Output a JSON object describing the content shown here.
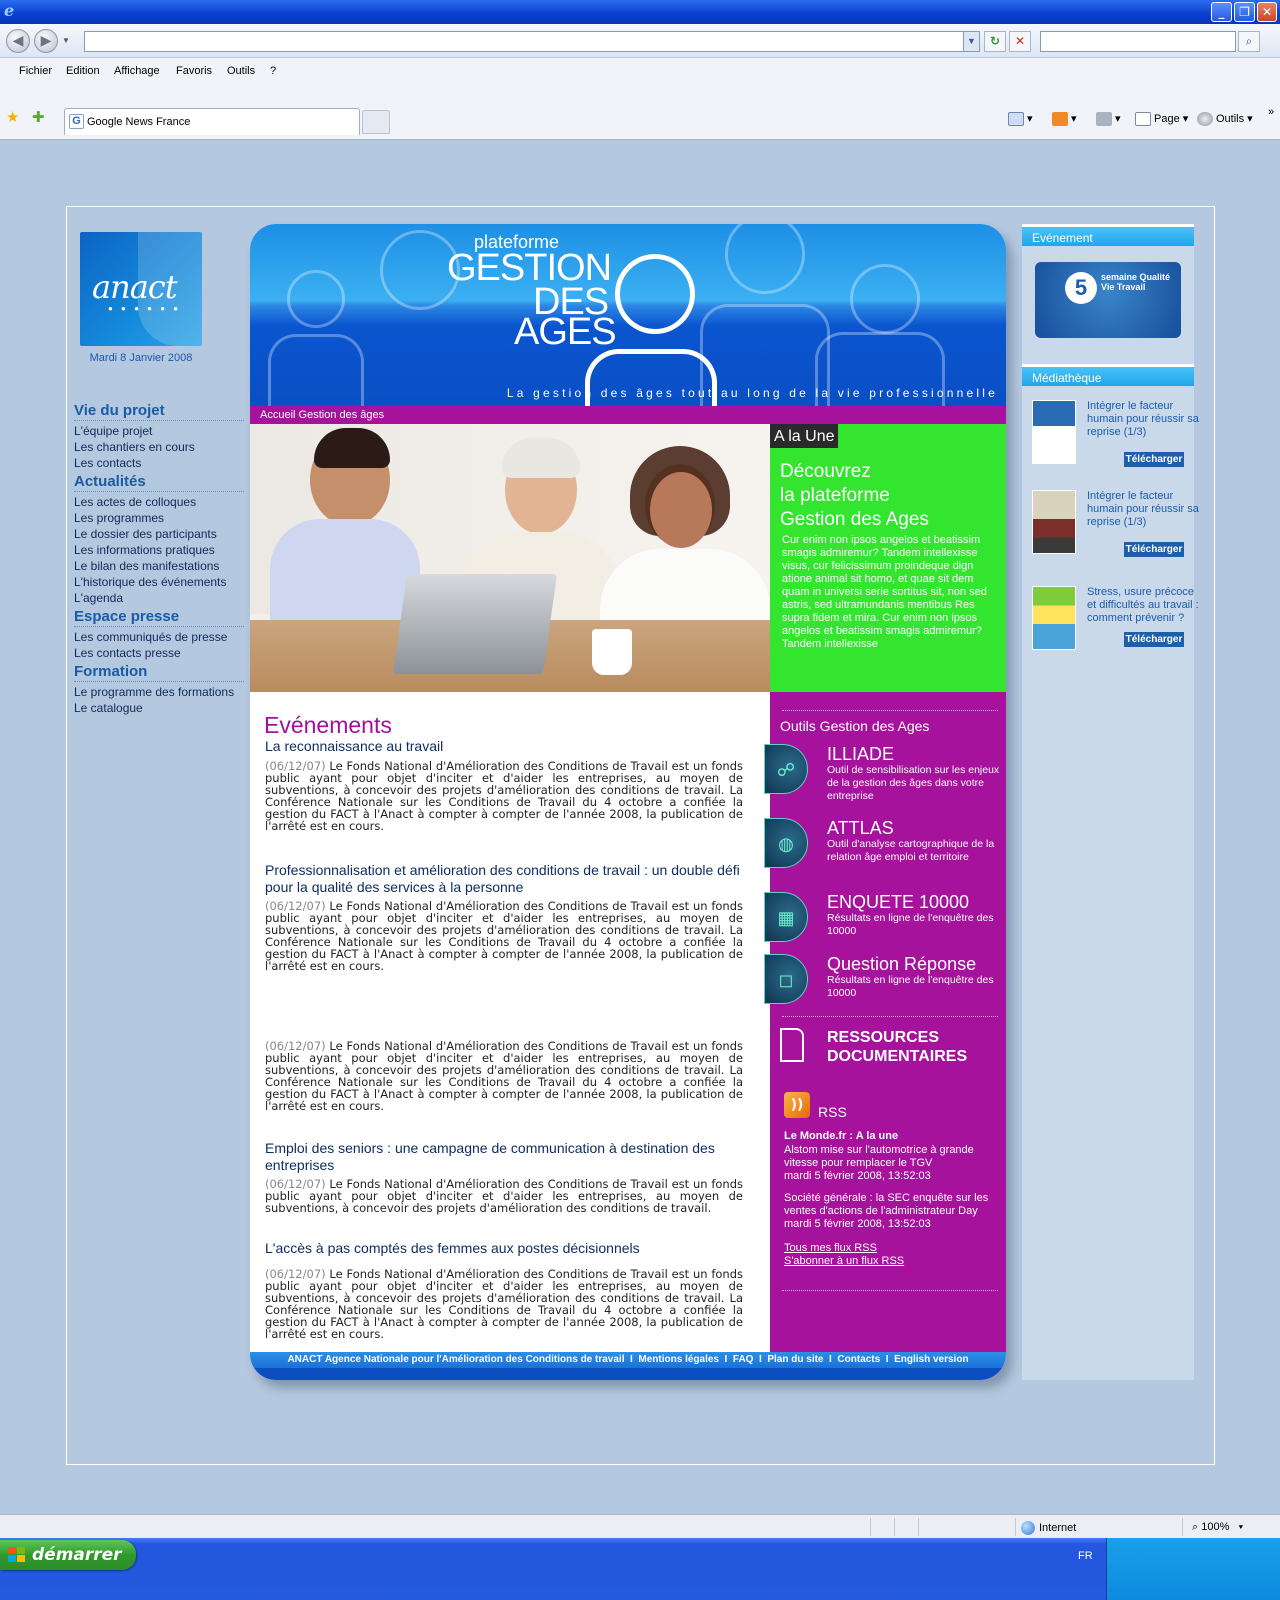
{
  "browser": {
    "menu": [
      "Fichier",
      "Edition",
      "Affichage",
      "Favoris",
      "Outils",
      "?"
    ],
    "tab_title": "Google News France",
    "address_value": "",
    "search_value": "",
    "cmd_page": "Page",
    "cmd_tools": "Outils",
    "status_zone": "Internet",
    "zoom": "100%"
  },
  "taskbar": {
    "start_label": "démarrer",
    "lang": "FR"
  },
  "site": {
    "logo_word": "anact",
    "date": "Mardi 8 Janvier 2008",
    "banner": {
      "pre": "plateforme",
      "line1": "GESTION",
      "line2": "DES",
      "line3": "AGES",
      "tagline": "La gestion des âges tout au long de la vie professionnelle"
    },
    "breadcrumb": "Accueil Gestion des âges",
    "nav": [
      {
        "head": "Vie du projet",
        "items": [
          "L'équipe projet",
          "Les chantiers en cours",
          "Les contacts"
        ]
      },
      {
        "head": "Actualités",
        "items": [
          "Les actes de colloques",
          "Les programmes",
          "Le dossier des participants",
          "Les informations pratiques",
          "Le bilan des manifestations",
          "L'historique des événements",
          "L'agenda"
        ]
      },
      {
        "head": "Espace presse",
        "items": [
          "Les communiqués de presse",
          "Les contacts presse"
        ]
      },
      {
        "head": "Formation",
        "items": [
          "Le programme des formations",
          "Le catalogue"
        ]
      }
    ],
    "une": {
      "tag": "A la Une",
      "title_l1": "Découvrez",
      "title_l2": "la plateforme",
      "title_l3": "Gestion des Ages",
      "text": "Cur enim non ipsos angelos et beatissim smagis admiremur? Tandem intellexisse visus, cur felicissimum proindeque dign atione animal sit homo, et quae sit dem quam in universi serie sortitus sit, non sed astris, sed ultramundanis mentibus Res supra fidem et mira. Cur enim non ipsos angelos et beatissim smagis admiremur? Tandem intellexisse"
    },
    "events": {
      "heading": "Evénements",
      "items": [
        {
          "title": "La reconnaissance au travail",
          "date": "(06/12/07)",
          "text": " Le Fonds National d'Amélioration des Conditions de Travail est un fonds public ayant pour objet d'inciter et d'aider les entreprises, au moyen de subventions, à concevoir des projets d'amélioration des conditions de travail. La Conférence Nationale sur les Conditions de Travail du 4 octobre a confiée la gestion du FACT à l'Anact à compter à compter de l'année 2008, la publication de l'arrêté est en cours."
        },
        {
          "title": "Professionnalisation et amélioration des conditions de travail : un double défi pour la qualité des services à la personne",
          "date": "(06/12/07)",
          "text": " Le Fonds National d'Amélioration des Conditions de Travail est un fonds public ayant pour objet d'inciter et d'aider les entreprises, au moyen de subventions, à concevoir des projets d'amélioration des conditions de travail. La Conférence Nationale sur les Conditions de Travail du 4 octobre a confiée la gestion du FACT à l'Anact à compter à compter de l'année 2008, la publication de l'arrêté est en cours."
        },
        {
          "title": "",
          "date": "(06/12/07)",
          "text": " Le Fonds National d'Amélioration des Conditions de Travail est un fonds public ayant pour objet d'inciter et d'aider les entreprises, au moyen de subventions, à concevoir des projets d'amélioration des conditions de travail. La Conférence Nationale sur les Conditions de Travail du 4 octobre a confiée la gestion du FACT à l'Anact à compter à compter de l'année 2008, la publication de l'arrêté est en cours."
        },
        {
          "title": "Emploi des seniors : une campagne de communication à destination des entreprises",
          "date": "(06/12/07)",
          "text": " Le Fonds National d'Amélioration des Conditions de Travail est un fonds public ayant pour objet d'inciter et d'aider les entreprises, au moyen de subventions, à concevoir des projets d'amélioration des conditions de travail."
        },
        {
          "title": "L'accès à pas comptés des femmes aux postes décisionnels",
          "date": "(06/12/07)",
          "text": " Le Fonds National d'Amélioration des Conditions de Travail est un fonds public ayant pour objet d'inciter et d'aider les entreprises, au moyen de subventions, à concevoir des projets d'amélioration des conditions de travail. La Conférence Nationale sur les Conditions de Travail du 4 octobre a confiée la gestion du FACT à l'Anact à compter à compter de l'année 2008, la publication de l'arrêté est en cours."
        }
      ]
    },
    "tools": {
      "heading": "Outils Gestion des Ages",
      "items": [
        {
          "name": "ILLIADE",
          "desc": "Outil de sensibilisation sur les enjeux de la gestion des âges dans votre entreprise",
          "icon": "network-icon"
        },
        {
          "name": "ATTLAS",
          "desc": "Outil d'analyse cartographique de la relation âge emploi et territoire",
          "icon": "globe-icon"
        },
        {
          "name": "ENQUETE 10000",
          "desc": "Résultats en ligne de l'enquêtre des 10000",
          "icon": "chart-icon"
        },
        {
          "name": "Question Réponse",
          "desc": "Résultats en ligne de l'enquêtre des 10000",
          "icon": "speech-bubble-icon"
        }
      ],
      "ressources_l1": "RESSOURCES",
      "ressources_l2": "DOCUMENTAIRES"
    },
    "rss": {
      "label": "RSS",
      "source": "Le Monde.fr : A la une",
      "items": [
        {
          "text": "Alstom mise sur l'automotrice à grande vitesse pour remplacer le TGV",
          "date": "mardi 5 février 2008, 13:52:03"
        },
        {
          "text": "Société générale : la SEC enquête sur les ventes d'actions de l'administrateur Day",
          "date": "mardi 5 février 2008, 13:52:03"
        }
      ],
      "link_all": "Tous mes flux RSS",
      "link_sub": "S'abonner à un flux RSS"
    },
    "footer": {
      "org": "ANACT Agence Nationale pour l'Amélioration des Conditions de travail",
      "links": [
        "Mentions légales",
        "FAQ",
        "Plan du site",
        "Contacts",
        "English version"
      ]
    },
    "right": {
      "event_head": "Evénement",
      "event_img_num": "5",
      "event_img_text": "semaine Qualité Vie Travail",
      "media_head": "Médiathèque",
      "media": [
        {
          "title": "Intégrer le facteur humain pour réussir sa reprise (1/3)",
          "button": "Télécharger"
        },
        {
          "title": "Intégrer le facteur humain pour réussir sa reprise (1/3)",
          "button": "Télécharger"
        },
        {
          "title": "Stress, usure précoce et difficultés au travail : comment prévenir ?",
          "button": "Télécharger"
        }
      ]
    }
  },
  "colors": {
    "brand_blue": "#1a5ba6",
    "magenta": "#a6129b",
    "green": "#33e52f",
    "sky": "#21a6ec"
  }
}
